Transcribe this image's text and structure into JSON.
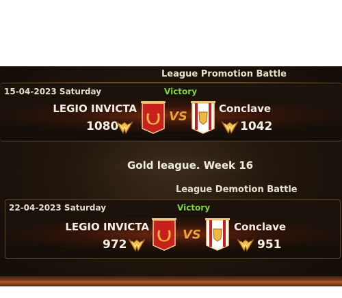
{
  "matches": [
    {
      "title": "League Promotion Battle",
      "date": "15-04-2023 Saturday",
      "result": "Victory",
      "left_team": "LEGIO INVICTA",
      "left_score": "1080",
      "vs": "VS",
      "right_team": "Conclave",
      "right_score": "1042"
    },
    {
      "title": "League Demotion Battle",
      "date": "22-04-2023 Saturday",
      "result": "Victory",
      "left_team": "LEGIO INVICTA",
      "left_score": "972",
      "vs": "VS",
      "right_team": "Conclave",
      "right_score": "951"
    }
  ],
  "week_header": "Gold league. Week 16",
  "colors": {
    "victory": "#7fd43a",
    "vs": "#e6a23a",
    "banner_red": "#c8201c",
    "emblem_gold": "#f0b840"
  },
  "icons": [
    "laurel-banner-icon",
    "lion-banner-icon",
    "gold-wings-rank-icon"
  ]
}
